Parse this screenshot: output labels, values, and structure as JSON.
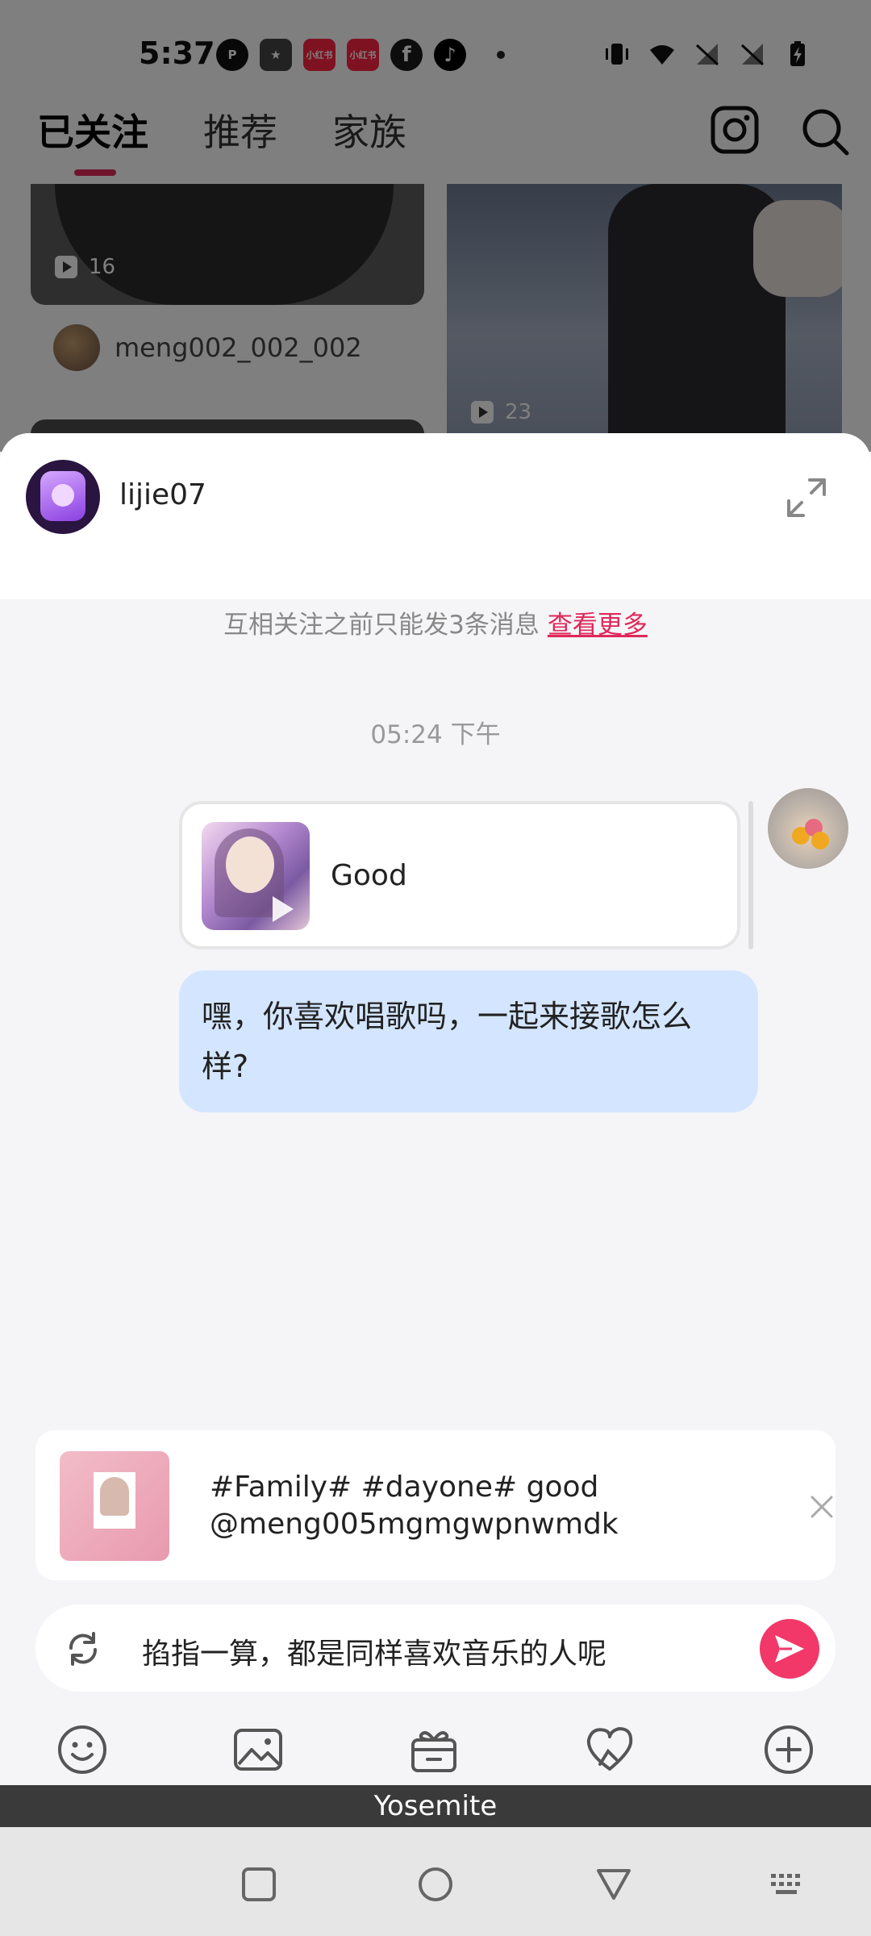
{
  "status_bar": {
    "time": "5:37",
    "app_icons": [
      {
        "name": "p-app-icon",
        "color": "#111111",
        "label": "P"
      },
      {
        "name": "star-app-icon",
        "color": "#333333",
        "label": "★"
      },
      {
        "name": "xiaohongshu-icon",
        "color": "#ff2442",
        "label": "小红书"
      },
      {
        "name": "xiaohongshu-icon-2",
        "color": "#ff2442",
        "label": "小红书"
      },
      {
        "name": "facebook-icon",
        "color": "#1b1b1b",
        "label": "f"
      },
      {
        "name": "tiktok-icon",
        "color": "#000000",
        "label": "♪"
      }
    ]
  },
  "background_app": {
    "tabs": [
      {
        "label": "已关注",
        "active": true
      },
      {
        "label": "推荐",
        "active": false
      },
      {
        "label": "家族",
        "active": false
      }
    ],
    "accent_color": "#e0285a",
    "left_card_play_count": "16",
    "left_card_author": "meng002_002_002",
    "right_card_play_count": "23"
  },
  "chat": {
    "peer_name": "lijie07",
    "notice_text": "互相关注之前只能发3条消息",
    "notice_link": "查看更多",
    "timestamp": "05:24 下午",
    "shared_video_title": "Good",
    "message_text": "嘿，你喜欢唱歌吗，一起来接歌怎么样?",
    "suggestion_line1": "#Family#  #dayone# good",
    "suggestion_line2": "@meng005mgmgwpnwmdk",
    "input_value": "掐指一算，都是同样喜欢音乐的人呢",
    "send_color": "#f23868",
    "message_bubble_color": "#d4e6ff",
    "toolbar_icons": [
      "emoji-icon",
      "image-icon",
      "gift-icon",
      "heart-badge-icon",
      "plus-icon"
    ]
  },
  "keyboard_bar": {
    "label": "Yosemite"
  },
  "nav_bar": {
    "buttons": [
      "recents-button",
      "home-button",
      "back-button",
      "keyboard-switch-button"
    ]
  }
}
